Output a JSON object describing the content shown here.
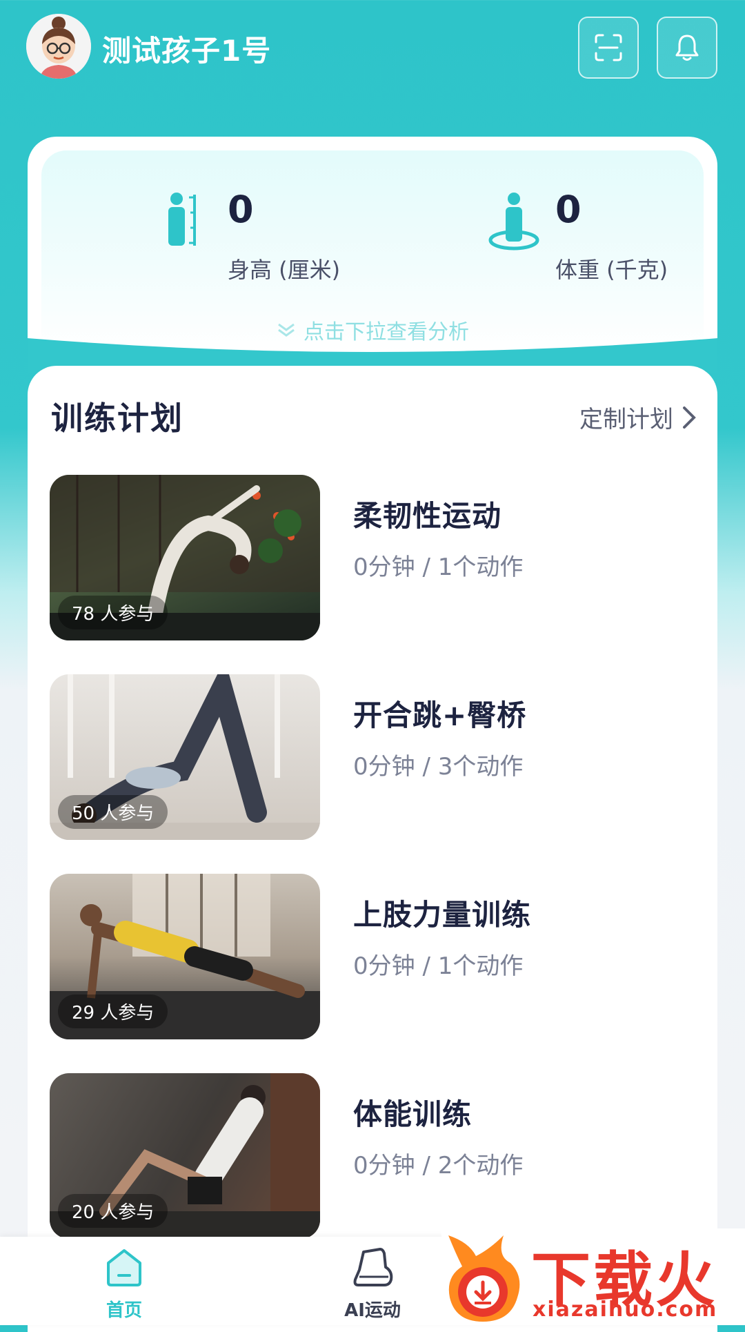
{
  "header": {
    "username": "测试孩子1号"
  },
  "stats": {
    "height_value": "0",
    "height_label": "身高 (厘米)",
    "weight_value": "0",
    "weight_label": "体重 (千克)",
    "pull_hint": "点击下拉查看分析"
  },
  "plans": {
    "title": "训练计划",
    "custom_label": "定制计划",
    "items": [
      {
        "name": "柔韧性运动",
        "meta": "0分钟 / 1个动作",
        "participants": "78 人参与"
      },
      {
        "name": "开合跳+臀桥",
        "meta": "0分钟 / 3个动作",
        "participants": "50 人参与"
      },
      {
        "name": "上肢力量训练",
        "meta": "0分钟 / 1个动作",
        "participants": "29 人参与"
      },
      {
        "name": "体能训练",
        "meta": "0分钟 / 2个动作",
        "participants": "20 人参与"
      }
    ]
  },
  "nav": {
    "home_label": "首页",
    "ai_label": "AI运动"
  },
  "watermark": {
    "cn": "下载火",
    "en": "xiazaihuo.com"
  },
  "colors": {
    "brand": "#2ec4c9",
    "text_dark": "#1d2340",
    "text_muted": "#7c8296",
    "watermark": "#e8382c"
  }
}
